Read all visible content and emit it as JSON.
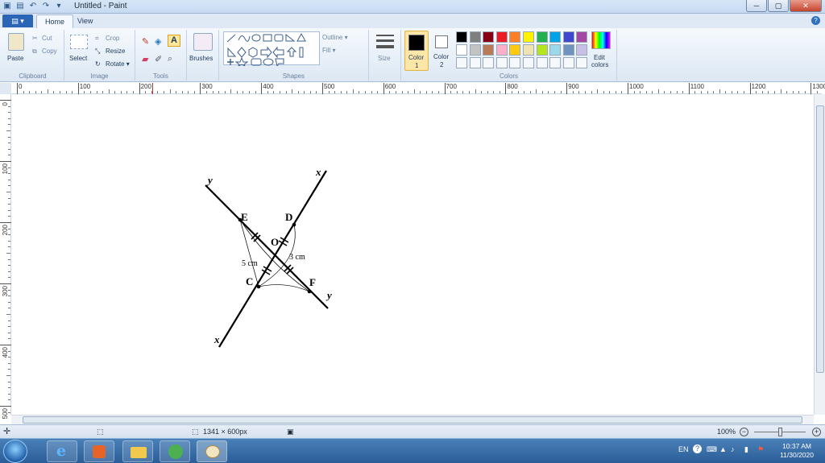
{
  "window": {
    "title": "Untitled - Paint",
    "minimize": "─",
    "maximize": "▢",
    "close": "✕"
  },
  "tabs": {
    "file": "▤ ▾",
    "home": "Home",
    "view": "View",
    "help": "?"
  },
  "ribbon": {
    "clipboard": {
      "label": "Clipboard",
      "paste": "Paste",
      "cut": "Cut",
      "copy": "Copy"
    },
    "image": {
      "label": "Image",
      "select": "Select",
      "crop": "Crop",
      "resize": "Resize",
      "rotate": "Rotate ▾"
    },
    "tools": {
      "label": "Tools"
    },
    "brushes": {
      "label": "Brushes"
    },
    "shapes": {
      "label": "Shapes",
      "outline": "Outline ▾",
      "fill": "Fill ▾"
    },
    "size": {
      "label": "Size"
    },
    "color1": {
      "label": "Color",
      "num": "1"
    },
    "color2": {
      "label": "Color",
      "num": "2"
    },
    "colors": {
      "label": "Colors",
      "edit": "Edit",
      "edit2": "colors"
    }
  },
  "palette": {
    "row1": [
      "#000000",
      "#7f7f7f",
      "#880015",
      "#ed1c24",
      "#ff7f27",
      "#fff200",
      "#22b14c",
      "#00a2e8",
      "#3f48cc",
      "#a349a4"
    ],
    "row2": [
      "#ffffff",
      "#c3c3c3",
      "#b97a57",
      "#ffaec9",
      "#ffc90e",
      "#efe4b0",
      "#b5e61d",
      "#99d9ea",
      "#7092be",
      "#c8bfe7"
    ],
    "color1": "#000000",
    "color2": "#ffffff"
  },
  "ruler": {
    "h": [
      "0",
      "100",
      "200",
      "300",
      "400",
      "500",
      "600",
      "700",
      "800",
      "900",
      "1000",
      "1100",
      "1200",
      "1300"
    ],
    "v": [
      "0",
      "100",
      "200",
      "300",
      "400",
      "500"
    ]
  },
  "drawing": {
    "labels": {
      "y_top": "y",
      "x_top": "x",
      "E": "E",
      "D": "D",
      "O": "O",
      "len1": "5 cm",
      "len2": "3 cm",
      "C": "C",
      "F": "F",
      "y_bottom": "y",
      "x_bottom": "x"
    }
  },
  "status": {
    "size": "1341 × 600px",
    "zoom": "100%"
  },
  "taskbar": {
    "lang": "EN",
    "time": "10:37 AM",
    "date": "11/30/2020"
  }
}
